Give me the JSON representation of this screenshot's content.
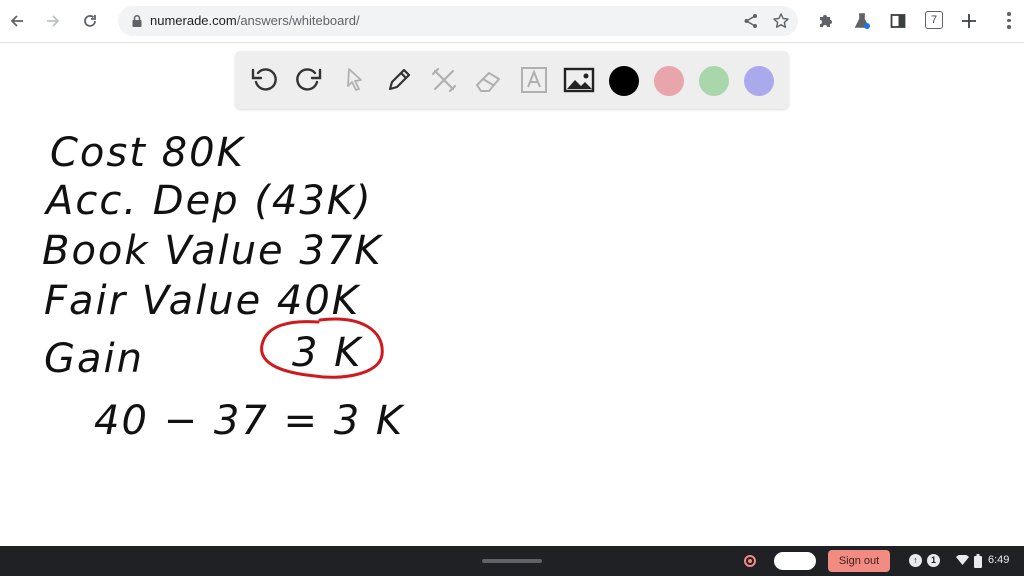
{
  "browser": {
    "url_host": "numerade.com",
    "url_path": "/answers/whiteboard/",
    "tab_count": "7"
  },
  "toolbar": {
    "tools": [
      "undo-icon",
      "redo-icon",
      "pointer-icon",
      "pen-icon",
      "tools-icon",
      "eraser-icon",
      "text-icon",
      "image-icon"
    ],
    "colors": {
      "black": "#000000",
      "pink": "#e8a5ab",
      "green": "#a9d7ab",
      "purple": "#a9a9ec"
    }
  },
  "whiteboard": {
    "lines": {
      "cost": "Cost  80K",
      "acc_dep": "Acc. Dep (43K)",
      "book_value": "Book Value  37K",
      "fair_value": "Fair Value  40K",
      "gain_label": "Gain",
      "gain_value": "3 K",
      "calc": "40 − 37 = 3 K"
    },
    "ink_color": "#111111",
    "circle_color": "#d0191c"
  },
  "shelf": {
    "sign_out_label": "Sign out",
    "notification_count": "1",
    "time": "6:49"
  }
}
